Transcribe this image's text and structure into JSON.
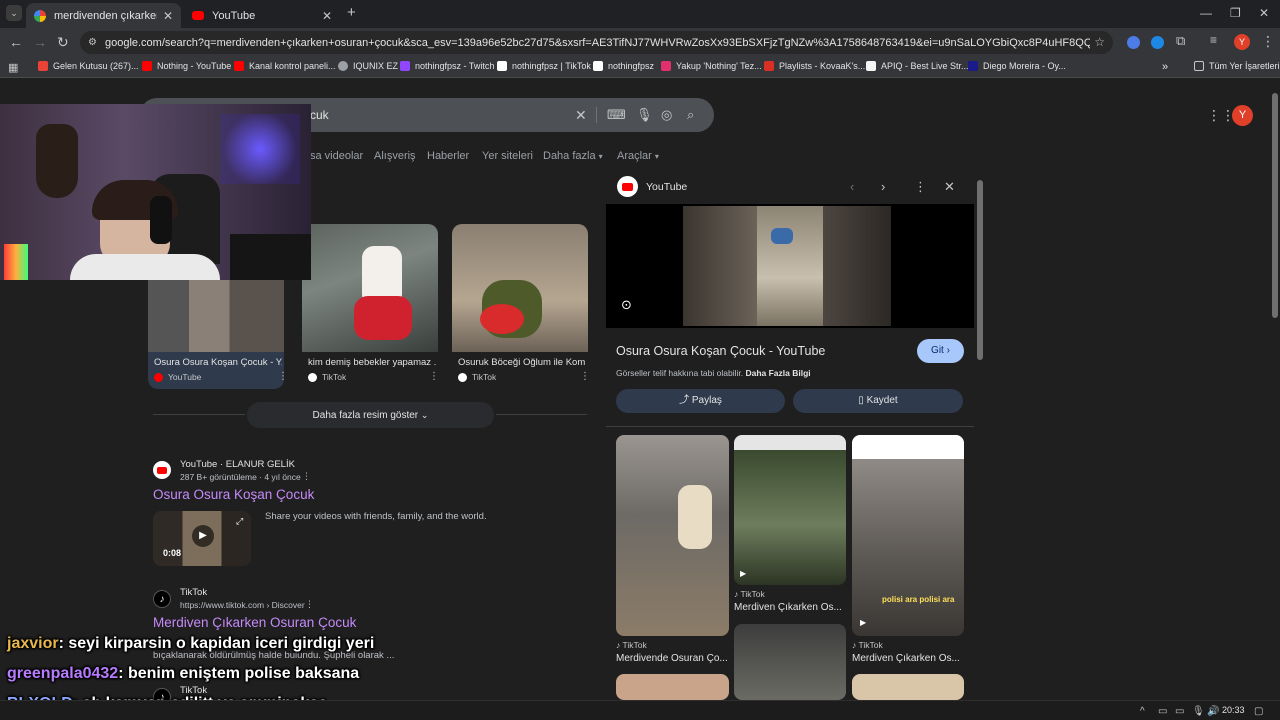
{
  "browser": {
    "tabs": [
      {
        "title": "merdivenden çıkarken osuran ç",
        "active": true,
        "favicon": "google-icon"
      },
      {
        "title": "YouTube",
        "active": false,
        "favicon": "youtube-icon"
      }
    ],
    "new_tab_label": "+",
    "url": "google.com/search?q=merdivenden+çıkarken+osuran+çocuk&sca_esv=139a96e52bc27d75&sxsrf=AE3TifNJ77WHVRwZosXx93EbSXFjzTgNZw%3A1758648763419&ei=u9nSaLOYGbiQxc8P4uHF8QQ&oq=merdivenden+çıkarken+osuran&...",
    "profile_initial": "Y",
    "accent": "#e0402a"
  },
  "bookmarks": {
    "items": [
      {
        "label": "Gelen Kutusu (267)...",
        "color": "#ea4335"
      },
      {
        "label": "Nothing - YouTube",
        "color": "#ff0000"
      },
      {
        "label": "Kanal kontrol paneli...",
        "color": "#ff0000"
      },
      {
        "label": "IQUNIX EZ",
        "color": "#9aa0a6"
      },
      {
        "label": "nothingfpsz - Twitch",
        "color": "#9146ff"
      },
      {
        "label": "nothingfpsz | TikTok",
        "color": "#ffffff"
      },
      {
        "label": "nothingfpsz",
        "color": "#ffffff"
      },
      {
        "label": "Yakup 'Nothing' Tez...",
        "color": "#e1306c"
      },
      {
        "label": "Playlists - KovaaK's...",
        "color": "#d93025"
      },
      {
        "label": "APIQ - Best Live Str...",
        "color": "#f5f5f5"
      },
      {
        "label": "Diego Moreira - Oy...",
        "color": "#1a1a8a"
      }
    ],
    "more_label": "»",
    "all_label": "Tüm Yer İşaretleri"
  },
  "search": {
    "query_visible": "cuk",
    "tabs": [
      "sa videolar",
      "Alışveriş",
      "Haberler",
      "Yer siteleri",
      "Daha fazla",
      "Araçlar"
    ]
  },
  "images": [
    {
      "caption": "Osura Osura Koşan Çocuk - Y...",
      "source": "YouTube",
      "src_color": "#ff0000"
    },
    {
      "caption": "kim demiş bebekler yapamaz ...",
      "source": "TikTok",
      "src_color": "#ffffff"
    },
    {
      "caption": "Osuruk Böceği Oğlum ile Kom...",
      "source": "TikTok",
      "src_color": "#ffffff"
    }
  ],
  "more_images_label": "Daha fazla resim göster",
  "results": [
    {
      "site": "YouTube · ELANUR GELİK",
      "sub": "287 B+ görüntüleme · 4 yıl önce",
      "title": "Osura Osura Koşan Çocuk",
      "desc": "Share your videos with friends, family, and the world.",
      "duration": "0:08"
    },
    {
      "site": "TikTok",
      "sub": "https://www.tiktok.com › Discover",
      "title": "Merdiven Çıkarken Osuran Çocuk",
      "desc_line2": "bıçaklanarak öldürülmüş halde bulundu. Şüpheli olarak ..."
    },
    {
      "site": "TikTok"
    }
  ],
  "panel": {
    "source": "YouTube",
    "title": "Osura Osura Koşan Çocuk - YouTube",
    "note_prefix": "Görseller telif hakkına tabi olabilir.",
    "note_link": "Daha Fazla Bilgi",
    "go_label": "Git",
    "share_label": "Paylaş",
    "save_label": "Kaydet",
    "related": [
      {
        "source": "TikTok",
        "caption": "Merdivende Osuran Ço..."
      },
      {
        "source": "TikTok",
        "caption": "Merdiven Çıkarken Os..."
      },
      {
        "source": "TikTok",
        "caption": "Merdiven Çıkarken Os..."
      }
    ],
    "related_overlay_2": "polisi ara polisi ara"
  },
  "chat": [
    {
      "user": "jaxvior",
      "color": "#e8b84a",
      "msg": ": seyi kirparsin o kapidan iceri girdigi yeri"
    },
    {
      "user": "greenpala0432",
      "color": "#b77cff",
      "msg": ": benim eniştem polise baksana"
    },
    {
      "user": "BLXOLD",
      "color": "#8fa8ff",
      "msg": ": ab kamyon edilitt ve amminakee"
    }
  ],
  "taskbar": {
    "time": "20:33"
  }
}
